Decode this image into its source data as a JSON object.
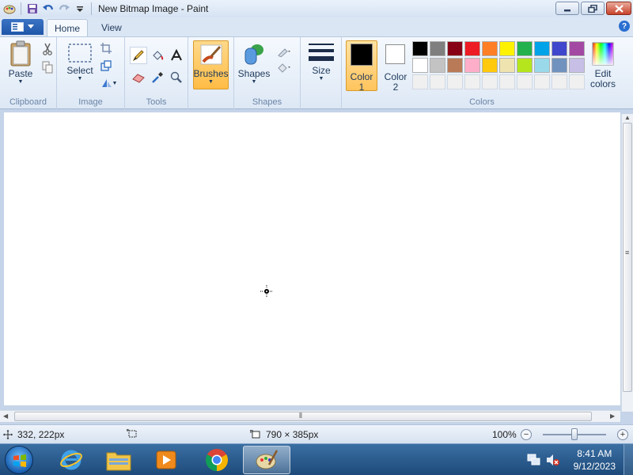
{
  "window": {
    "title": "New Bitmap Image - Paint",
    "controls": [
      "minimize",
      "maximize",
      "close"
    ]
  },
  "quick_access": [
    "save-icon",
    "undo-icon",
    "redo-icon",
    "customize-icon"
  ],
  "tabs": [
    {
      "label": "Home",
      "active": true
    },
    {
      "label": "View",
      "active": false
    }
  ],
  "ribbon": {
    "clipboard": {
      "group_label": "Clipboard",
      "paste_label": "Paste"
    },
    "image": {
      "group_label": "Image",
      "select_label": "Select"
    },
    "tools": {
      "group_label": "Tools"
    },
    "brushes_label": "Brushes",
    "shapes": {
      "group_label": "Shapes",
      "shapes_label": "Shapes"
    },
    "size_label": "Size",
    "colors": {
      "group_label": "Colors",
      "color1_line1": "Color",
      "color1_line2": "1",
      "color2_line1": "Color",
      "color2_line2": "2",
      "edit_line1": "Edit",
      "edit_line2": "colors",
      "color1_value": "#000000",
      "color2_value": "#ffffff",
      "palette_row1": [
        "#000000",
        "#7f7f7f",
        "#880015",
        "#ed1c24",
        "#ff7f27",
        "#fff200",
        "#22b14c",
        "#00a2e8",
        "#3f48cc",
        "#a349a4"
      ],
      "palette_row2": [
        "#ffffff",
        "#c3c3c3",
        "#b97a57",
        "#ffaec9",
        "#ffc90e",
        "#efe4b0",
        "#b5e61d",
        "#99d9ea",
        "#7092be",
        "#c8bfe7"
      ],
      "palette_row3": [
        "#f0f0f0",
        "#f0f0f0",
        "#f0f0f0",
        "#f0f0f0",
        "#f0f0f0",
        "#f0f0f0",
        "#f0f0f0",
        "#f0f0f0",
        "#f0f0f0",
        "#f0f0f0"
      ]
    }
  },
  "status": {
    "cursor_pos": "332, 222px",
    "canvas_size": "790 × 385px",
    "zoom": "100%"
  },
  "taskbar": {
    "apps": [
      "internet-explorer-icon",
      "file-explorer-icon",
      "media-player-icon",
      "chrome-icon",
      "paint-icon"
    ],
    "time": "8:41 AM",
    "date": "9/12/2023"
  }
}
